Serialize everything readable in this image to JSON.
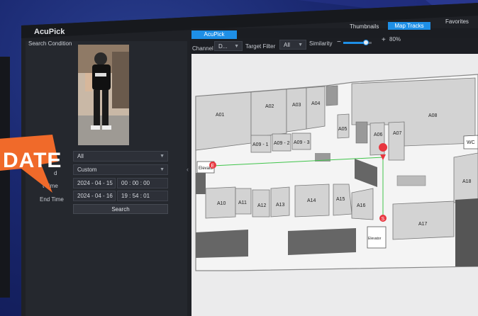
{
  "app": {
    "title": "AcuPick",
    "tab_active": "AcuPick"
  },
  "top_tabs": [
    {
      "label": "Thumbnails",
      "active": false
    },
    {
      "label": "Map Tracks",
      "active": true
    },
    {
      "label": "Favorites",
      "active": false
    }
  ],
  "search_panel": {
    "heading": "Search Condition",
    "type_value": "All",
    "mode_label": "d",
    "mode_value": "Custom",
    "start_label": "t Time",
    "start_date": "2024 - 04 - 15",
    "start_time": "00 : 00 : 00",
    "end_label": "End Time",
    "end_date": "2024 - 04 - 16",
    "end_time": "19 : 54 : 01",
    "search_button": "Search"
  },
  "filters": {
    "channel_label": "Channel",
    "channel_value": "D...",
    "target_label": "Target Filter",
    "target_value": "All",
    "similarity_label": "Similarity",
    "similarity_value": "80%",
    "similarity_level": 0.8
  },
  "map": {
    "rooms": [
      "A01",
      "A02",
      "A03",
      "A04",
      "A05",
      "A06",
      "A07",
      "A08",
      "A09 - 1",
      "A09 - 2",
      "A09 - 3",
      "A10",
      "A11",
      "A12",
      "A13",
      "A14",
      "A15",
      "A16",
      "A17",
      "A18",
      "WC"
    ],
    "elevator_left": "Elevato",
    "elevator_bottom": "Elevator",
    "start_marker": "E",
    "end_marker": "S"
  },
  "badge_text": "DATE",
  "colors": {
    "accent": "#1e8fe6",
    "badge": "#f06a2a",
    "track": "#3fc44a",
    "marker": "#e8363f"
  }
}
